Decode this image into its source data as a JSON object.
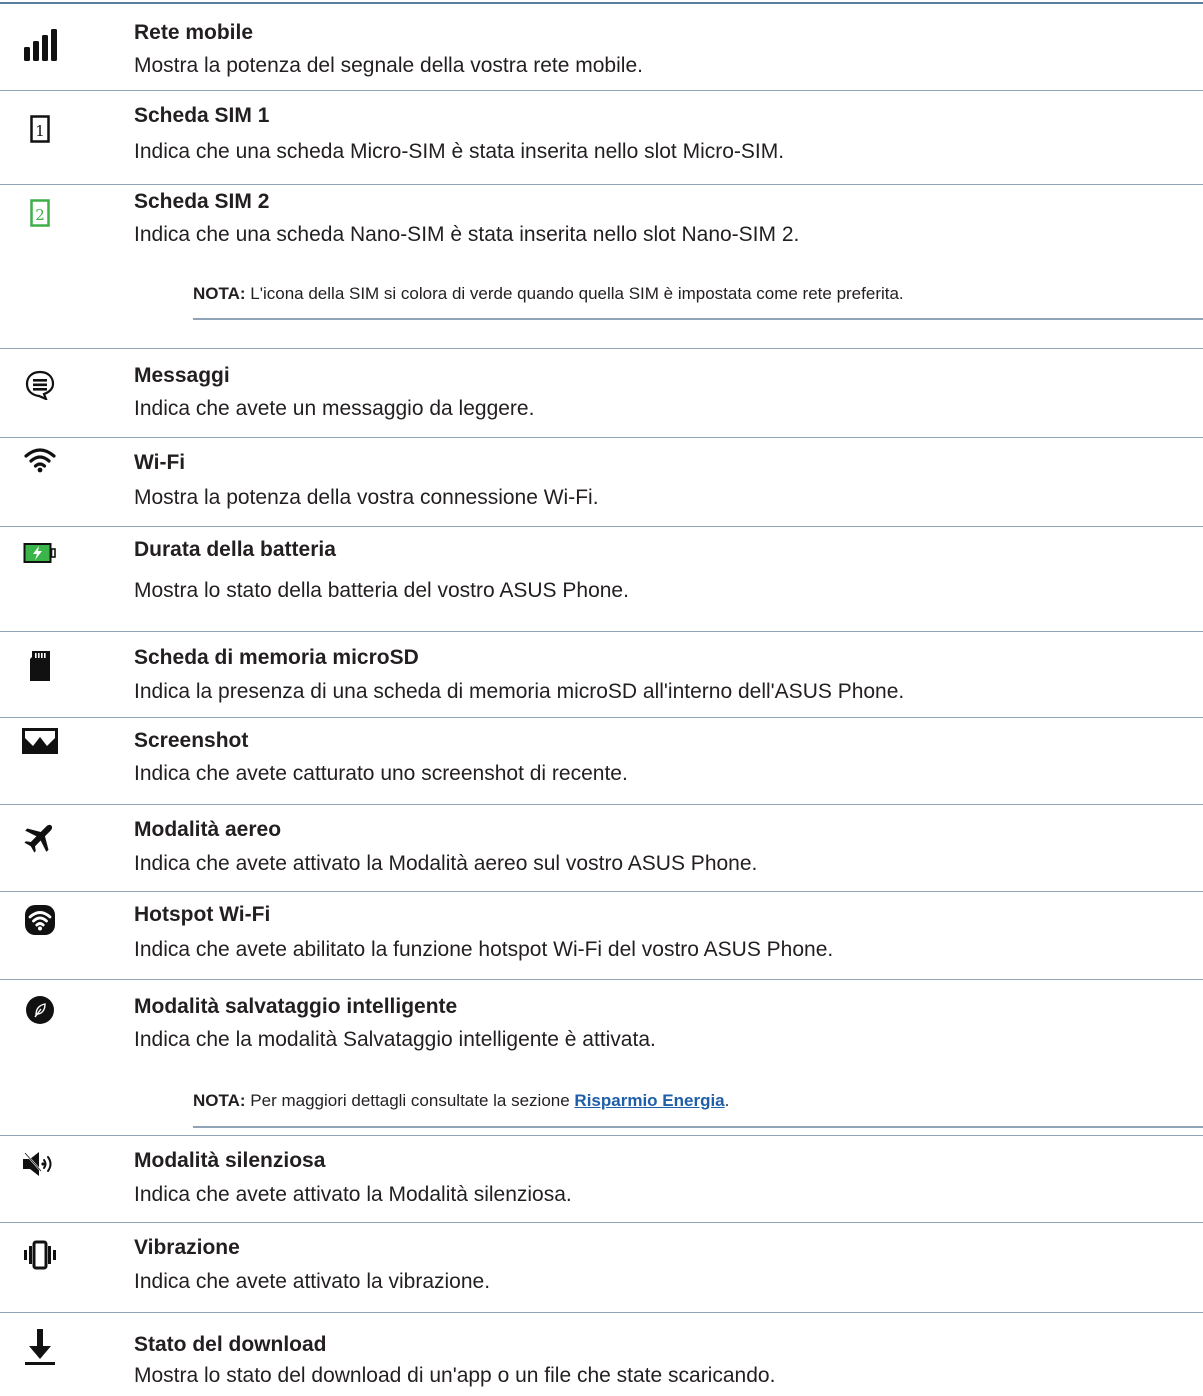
{
  "entries": [
    {
      "icon": "signal-bars-icon",
      "title": "Rete mobile",
      "desc": "Mostra la potenza del segnale della vostra rete mobile."
    },
    {
      "icon": "sim-card-1-icon",
      "title": "Scheda SIM 1",
      "desc": "Indica che una scheda Micro-SIM è stata inserita nello slot Micro-SIM."
    },
    {
      "icon": "sim-card-2-icon",
      "title": "Scheda SIM 2",
      "desc": "Indica che una scheda Nano-SIM è stata inserita nello slot Nano-SIM 2."
    },
    {
      "icon": "message-icon",
      "title": "Messaggi",
      "desc": "Indica che avete un messaggio da leggere."
    },
    {
      "icon": "wifi-icon",
      "title": "Wi-Fi",
      "desc": "Mostra la potenza della vostra connessione Wi-Fi."
    },
    {
      "icon": "battery-charging-icon",
      "title": "Durata della batteria",
      "desc": "Mostra lo stato della batteria del vostro ASUS Phone."
    },
    {
      "icon": "microsd-card-icon",
      "title": "Scheda di memoria microSD",
      "desc": "Indica la presenza di una scheda di memoria microSD all'interno dell'ASUS Phone."
    },
    {
      "icon": "screenshot-icon",
      "title": "Screenshot",
      "desc": "Indica che avete catturato uno screenshot di recente."
    },
    {
      "icon": "airplane-icon",
      "title": "Modalità aereo",
      "desc": "Indica che avete attivato la Modalità aereo sul vostro ASUS Phone."
    },
    {
      "icon": "hotspot-icon",
      "title": "Hotspot Wi-Fi",
      "desc": "Indica che avete abilitato la funzione hotspot Wi-Fi del vostro ASUS Phone."
    },
    {
      "icon": "smart-saving-leaf-icon",
      "title": "Modalità salvataggio intelligente",
      "desc": "Indica che la modalità Salvataggio intelligente è attivata."
    },
    {
      "icon": "silent-mode-icon",
      "title": "Modalità silenziosa",
      "desc": "Indica che avete attivato la Modalità silenziosa."
    },
    {
      "icon": "vibration-icon",
      "title": "Vibrazione",
      "desc": "Indica che avete attivato la vibrazione."
    },
    {
      "icon": "download-icon",
      "title": "Stato del download",
      "desc": "Mostra lo stato del download di un'app o un file che state scaricando."
    }
  ],
  "notes": {
    "sim": {
      "label": "NOTA:",
      "text": " L'icona della SIM si colora di verde quando quella SIM è impostata come rete preferita."
    },
    "smart": {
      "label": "NOTA:",
      "text_before": " Per maggiori dettagli consultate la sezione ",
      "link": "Risparmio Energia",
      "text_after": "."
    }
  },
  "colors": {
    "sim2_green": "#3fae49",
    "battery_green": "#39b54a",
    "rule": "#8fa4b6",
    "link": "#1f5ea8"
  }
}
